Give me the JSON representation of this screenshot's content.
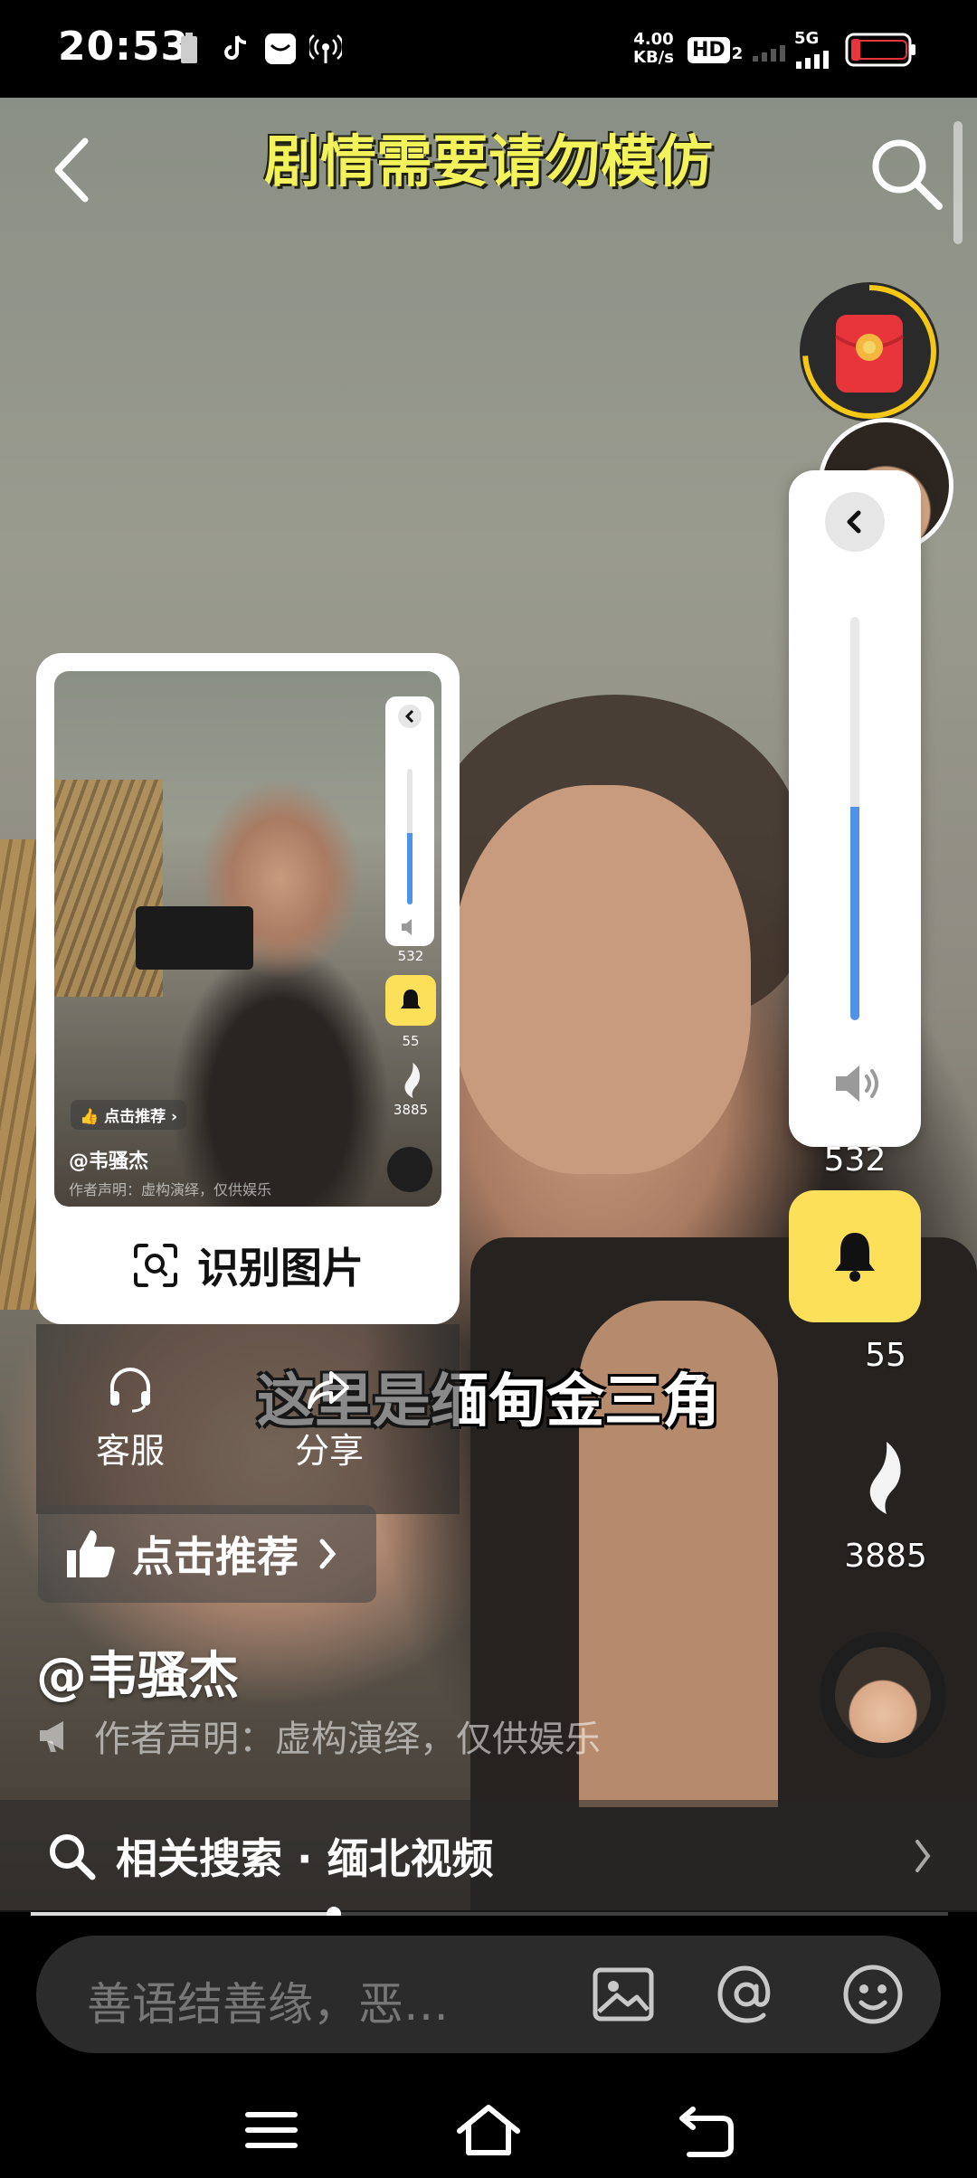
{
  "status_bar": {
    "time": "20:53",
    "net_speed_value": "4.00",
    "net_speed_unit": "KB/s",
    "hd_label": "HD",
    "hd_sub": "2",
    "network_label": "5G",
    "icons": [
      "battery-saver-icon",
      "tiktok-icon",
      "mail-icon",
      "hotspot-icon",
      "signal-icon",
      "battery-icon"
    ]
  },
  "video": {
    "warning_text": "剧情需要请勿模仿",
    "subtitle": "这里是缅甸金三角",
    "author_handle": "@韦骚杰",
    "author_claim": "作者声明：虚构演绎，仅供娱乐",
    "like_button_label": "点击推荐",
    "progress": 0.33
  },
  "right_rail": {
    "volume_level": 0.53,
    "count_532": "532",
    "count_55": "55",
    "count_3885": "3885"
  },
  "popup": {
    "thumb_handle": "@韦骚杰",
    "thumb_claim": "作者声明：虚构演绎，仅供娱乐",
    "thumb_like_label": "点击推荐",
    "thumb_count_532": "532",
    "thumb_count_55": "55",
    "thumb_count_3885": "3885",
    "recognize_label": "识别图片"
  },
  "actions": {
    "service_label": "客服",
    "share_label": "分享"
  },
  "related_search": {
    "label": "相关搜索 · 缅北视频"
  },
  "comment_bar": {
    "placeholder": "善语结善缘，恶…"
  },
  "colors": {
    "accent_yellow": "#fde05a",
    "volume_blue": "#4f93e9",
    "warning_yellow": "#f2f25a",
    "redpacket_red": "#e8343b"
  }
}
